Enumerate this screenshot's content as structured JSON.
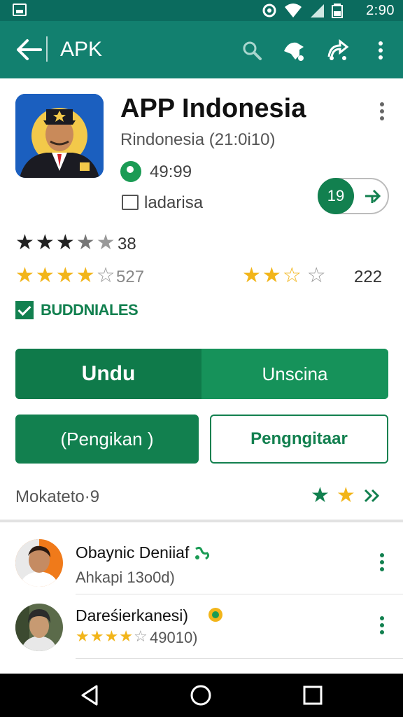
{
  "status_bar": {
    "time": "2:90",
    "icons": [
      "gallery-icon",
      "alarm-icon",
      "wifi-icon",
      "signal-icon",
      "battery-icon"
    ]
  },
  "app_bar": {
    "title": "APK",
    "actions": [
      "search-icon",
      "notification-icon",
      "share-icon",
      "more-vert-icon"
    ]
  },
  "app": {
    "title": "APP Indonesia",
    "developer": "Rindonesia  (21:0i10)",
    "price": "49:99",
    "category": "ladarisa",
    "badge": "19"
  },
  "ratings": {
    "row1": {
      "stars": 3.5,
      "count": "38"
    },
    "row2": {
      "stars": 4,
      "count": "527"
    },
    "row3": {
      "stars": 2.5,
      "count": "222"
    }
  },
  "check_label": "BUDDNIALES",
  "buttons": {
    "install": "Undu",
    "secondary": "Unscina",
    "left": "(Pengikan )",
    "right": "Pengngitaar"
  },
  "more_label": "Mokateto·9",
  "list": [
    {
      "title": "Obaynic Deniiaf",
      "subtitle": "Ahkapi 13o0d)"
    },
    {
      "title": "Dareśierkanesi)",
      "stars": 4,
      "subtitle": "49010)"
    }
  ],
  "colors": {
    "status_bar": "#0b6b5e",
    "app_bar": "#12806f",
    "accent_green": "#12804f",
    "star_gold": "#f2b51a",
    "star_dark": "#222222"
  }
}
